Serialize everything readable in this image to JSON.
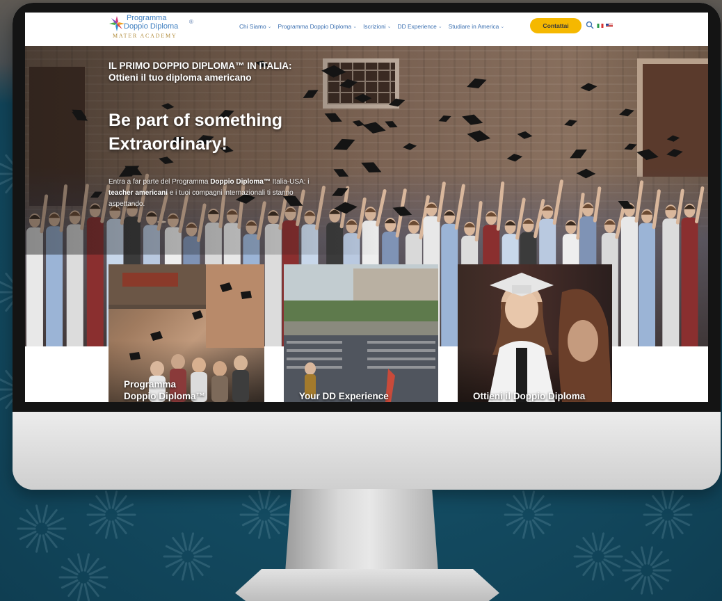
{
  "header": {
    "logo_line1": "Programma",
    "logo_line2": "Doppio Diploma",
    "logo_registered": "®",
    "logo_sub": "MATER ACADEMY",
    "nav": [
      {
        "label": "Chi Siamo"
      },
      {
        "label": "Programma Doppio Diploma"
      },
      {
        "label": "Iscrizioni"
      },
      {
        "label": "DD Experience"
      },
      {
        "label": "Studiare in America"
      }
    ],
    "contact_label": "Contattai",
    "flags": [
      "italian-flag",
      "us-flag"
    ]
  },
  "hero": {
    "kicker_line1": "IL PRIMO DOPPIO DIPLOMA™ IN ITALIA:",
    "kicker_line2": "Ottieni il tuo diploma americano",
    "headline_line1": "Be part of something",
    "headline_line2": "Extraordinary!",
    "body_part1": "Entra a far parte del Programma ",
    "body_bold1": "Doppio Diploma™",
    "body_part2": " Italia-USA: i ",
    "body_bold2": "teacher americani",
    "body_part3": " e i tuoi compagni internazionali ti stanno aspettando."
  },
  "cards": [
    {
      "title_line1": "Programma",
      "title_line2": "Doppio Diploma™"
    },
    {
      "title_line1": "Your DD Experience"
    },
    {
      "title_line1": "Ottieni il Doppio Diploma"
    }
  ],
  "colors": {
    "brand_blue": "#3a6fb0",
    "accent_yellow": "#f5b800",
    "backdrop_teal": "#124a5f"
  }
}
